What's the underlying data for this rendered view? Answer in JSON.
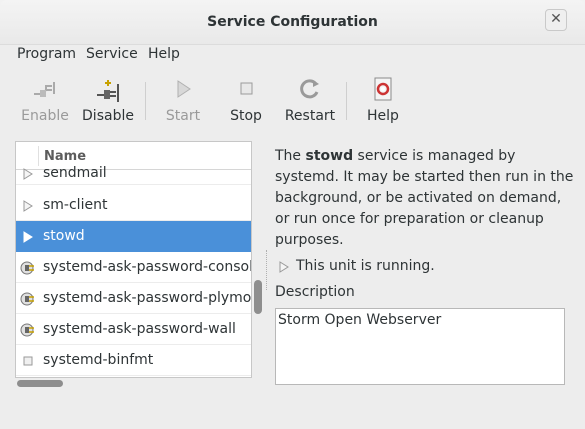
{
  "window": {
    "title": "Service Configuration",
    "close_icon": "close-icon"
  },
  "menu": [
    "Program",
    "Service",
    "Help"
  ],
  "toolbar": [
    {
      "id": "enable",
      "label": "Enable",
      "icon": "plug-connect-icon",
      "enabled": false
    },
    {
      "id": "disable",
      "label": "Disable",
      "icon": "plug-disconnect-icon",
      "enabled": true
    },
    {
      "id": "start",
      "label": "Start",
      "icon": "play-icon",
      "enabled": false
    },
    {
      "id": "stop",
      "label": "Stop",
      "icon": "stop-icon",
      "enabled": true
    },
    {
      "id": "restart",
      "label": "Restart",
      "icon": "restart-icon",
      "enabled": true
    },
    {
      "id": "help",
      "label": "Help",
      "icon": "help-icon",
      "enabled": true
    }
  ],
  "services": {
    "column_header": "Name",
    "rows": [
      {
        "name": "sendmail",
        "icon": "play-triangle-icon",
        "selected": false
      },
      {
        "name": "sm-client",
        "icon": "play-triangle-icon",
        "selected": false
      },
      {
        "name": "stowd",
        "icon": "play-triangle-icon",
        "selected": true
      },
      {
        "name": "systemd-ask-password-console",
        "icon": "plug-icon",
        "selected": false
      },
      {
        "name": "systemd-ask-password-plymouth",
        "icon": "plug-icon",
        "selected": false
      },
      {
        "name": "systemd-ask-password-wall",
        "icon": "plug-icon",
        "selected": false
      },
      {
        "name": "systemd-binfmt",
        "icon": "square-icon",
        "selected": false
      }
    ]
  },
  "info": {
    "text_before": "The ",
    "service_name": "stowd",
    "text_after": " service is managed by systemd. It may be started then run in the background, or be activated on demand, or run once for preparation or cleanup purposes.",
    "status": "This unit is running.",
    "description_label": "Description",
    "description": "Storm Open Webserver"
  },
  "colors": {
    "selection": "#4a90d9",
    "background": "#ededed"
  }
}
